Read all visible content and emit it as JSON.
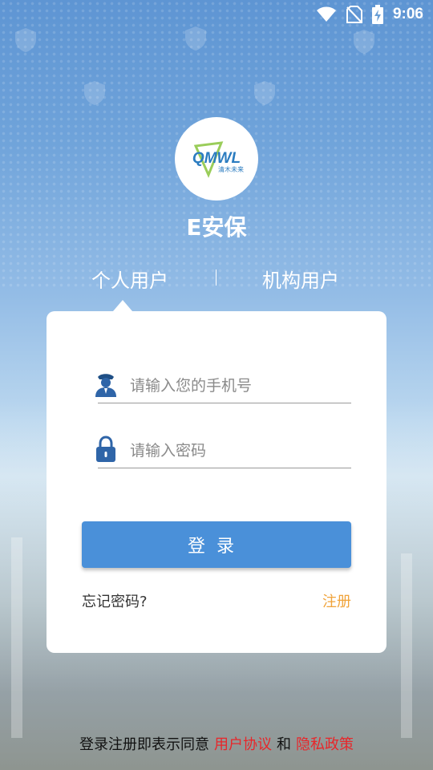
{
  "status_bar": {
    "time": "9:06",
    "icons": [
      "wifi-icon",
      "no-sim-icon",
      "battery-charging-icon"
    ]
  },
  "app": {
    "logo_text": "QMWL",
    "logo_subtext": "清木未来",
    "title": "E安保"
  },
  "tabs": [
    {
      "label": "个人用户",
      "selected": true
    },
    {
      "label": "机构用户",
      "selected": false
    }
  ],
  "form": {
    "phone_placeholder": "请输入您的手机号",
    "password_placeholder": "请输入密码",
    "login_label": "登录",
    "forgot_label": "忘记密码?",
    "register_label": "注册"
  },
  "footer": {
    "prefix": "登录注册即表示同意",
    "user_agreement": "用户协议",
    "and": "和",
    "privacy_policy": "隐私政策"
  },
  "colors": {
    "primary": "#4a90d9",
    "register": "#f0a33a",
    "link": "#e8262a"
  }
}
